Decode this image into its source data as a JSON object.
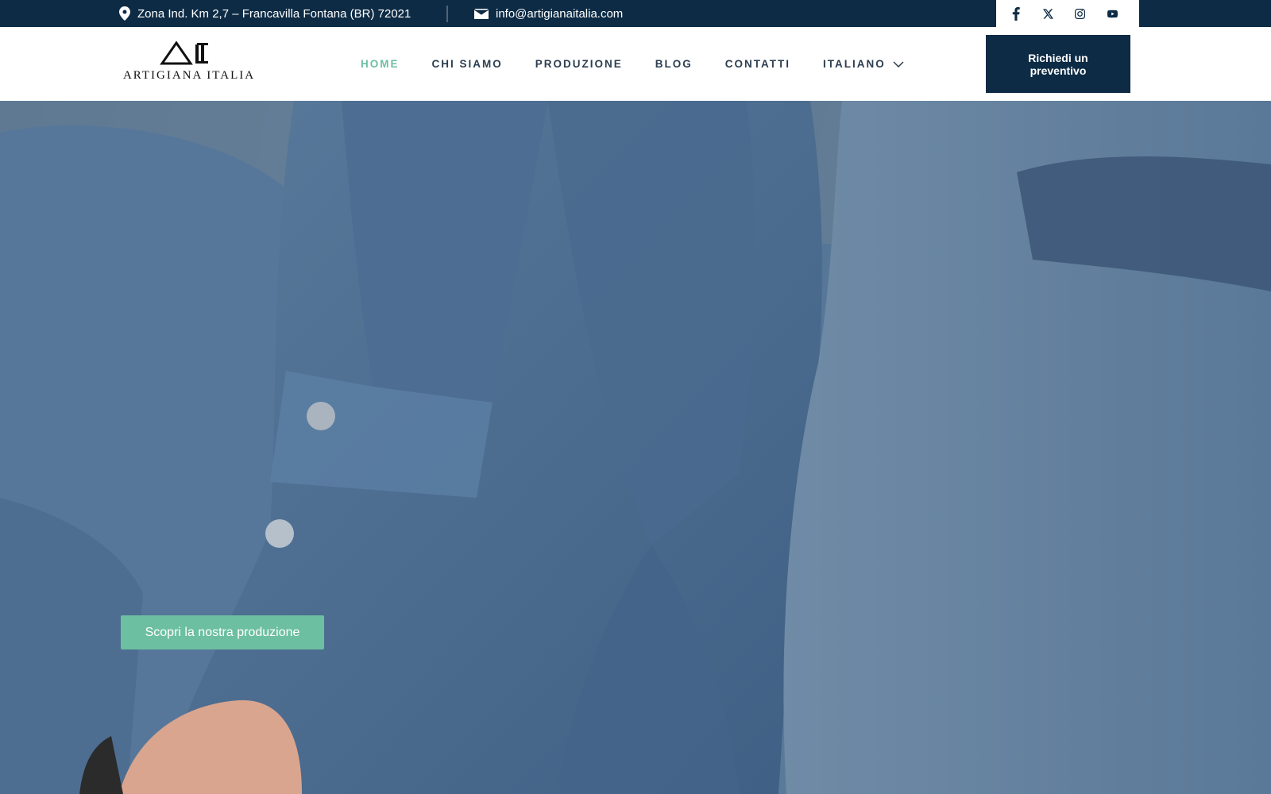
{
  "topbar": {
    "address": "Zona Ind. Km 2,7 – Francavilla Fontana (BR) 72021",
    "email": "info@artigianaitalia.com",
    "social": [
      "facebook-icon",
      "x-icon",
      "instagram-icon",
      "youtube-icon"
    ]
  },
  "header": {
    "logo_text": "ARTIGIANA ITALIA",
    "nav": [
      {
        "label": "HOME",
        "active": true
      },
      {
        "label": "CHI SIAMO"
      },
      {
        "label": "PRODUZIONE"
      },
      {
        "label": "BLOG"
      },
      {
        "label": "CONTATTI"
      },
      {
        "label": "ITALIANO",
        "dropdown": true
      }
    ],
    "cta_label": "Richiedi un preventivo"
  },
  "hero": {
    "button_label": "Scopri la nostra produzione"
  },
  "colors": {
    "navy": "#0d2b45",
    "accent_green": "#6cbfa1",
    "white": "#ffffff"
  }
}
